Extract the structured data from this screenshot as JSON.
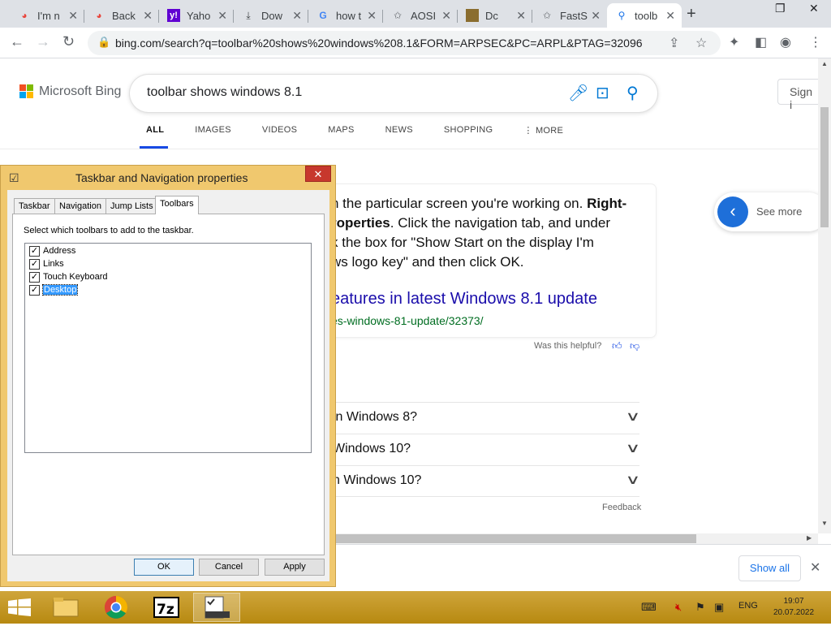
{
  "browser": {
    "tabs": [
      {
        "title": "I'm n",
        "icon": "chrome-icon"
      },
      {
        "title": "Back",
        "icon": "chrome-icon"
      },
      {
        "title": "Yaho",
        "icon": "yahoo-icon"
      },
      {
        "title": "Dow",
        "icon": "download-icon"
      },
      {
        "title": "how t",
        "icon": "google-icon"
      },
      {
        "title": "AOSI",
        "icon": "star-icon"
      },
      {
        "title": "Dc",
        "icon": "image-icon"
      },
      {
        "title": "FastS",
        "icon": "star-icon"
      },
      {
        "title": "toolb",
        "icon": "search-icon",
        "active": true
      }
    ],
    "url": "bing.com/search?q=toolbar%20shows%20windows%208.1&FORM=ARPSEC&PC=ARPL&PTAG=32096"
  },
  "bing": {
    "logo_text": "Microsoft Bing",
    "query": "toolbar shows windows 8.1",
    "signin": "Sign i",
    "scopes": [
      "ALL",
      "IMAGES",
      "VIDEOS",
      "MAPS",
      "NEWS",
      "SHOPPING",
      "⋮ MORE"
    ],
    "answer": {
      "line1_plain": "n the particular screen you're working on. ",
      "line1_bold": "Right-",
      "line2_bold": "roperties",
      "line2_plain": ". Click the navigation tab, and under",
      "line3": "k the box for \"Show Start on the display I'm",
      "line4": "ws logo key\" and then click OK.",
      "link": "eatures in latest Windows 8.1 update",
      "url": "es-windows-81-update/32373/"
    },
    "helpful": "Was this helpful?",
    "see_more": "See more",
    "faqs": [
      "in Windows 8?",
      "Windows 10?",
      "n Windows 10?"
    ],
    "feedback": "Feedback",
    "show_all": "Show all"
  },
  "dialog": {
    "title": "Taskbar and Navigation properties",
    "tabs": [
      "Taskbar",
      "Navigation",
      "Jump Lists",
      "Toolbars"
    ],
    "instruction": "Select which toolbars to add to the taskbar.",
    "toolbars": [
      {
        "label": "Address",
        "checked": true
      },
      {
        "label": "Links",
        "checked": true
      },
      {
        "label": "Touch Keyboard",
        "checked": true
      },
      {
        "label": "Desktop",
        "checked": true,
        "selected": true
      }
    ],
    "buttons": {
      "ok": "OK",
      "cancel": "Cancel",
      "apply": "Apply"
    }
  },
  "taskbar": {
    "language": "ENG",
    "time": "19:07",
    "date": "20.07.2022"
  },
  "colors": {
    "bing_blue": "#174ae4",
    "link": "#1a0dab",
    "taskbar": "#c1941a",
    "dialog_frame": "#f0c86e"
  }
}
